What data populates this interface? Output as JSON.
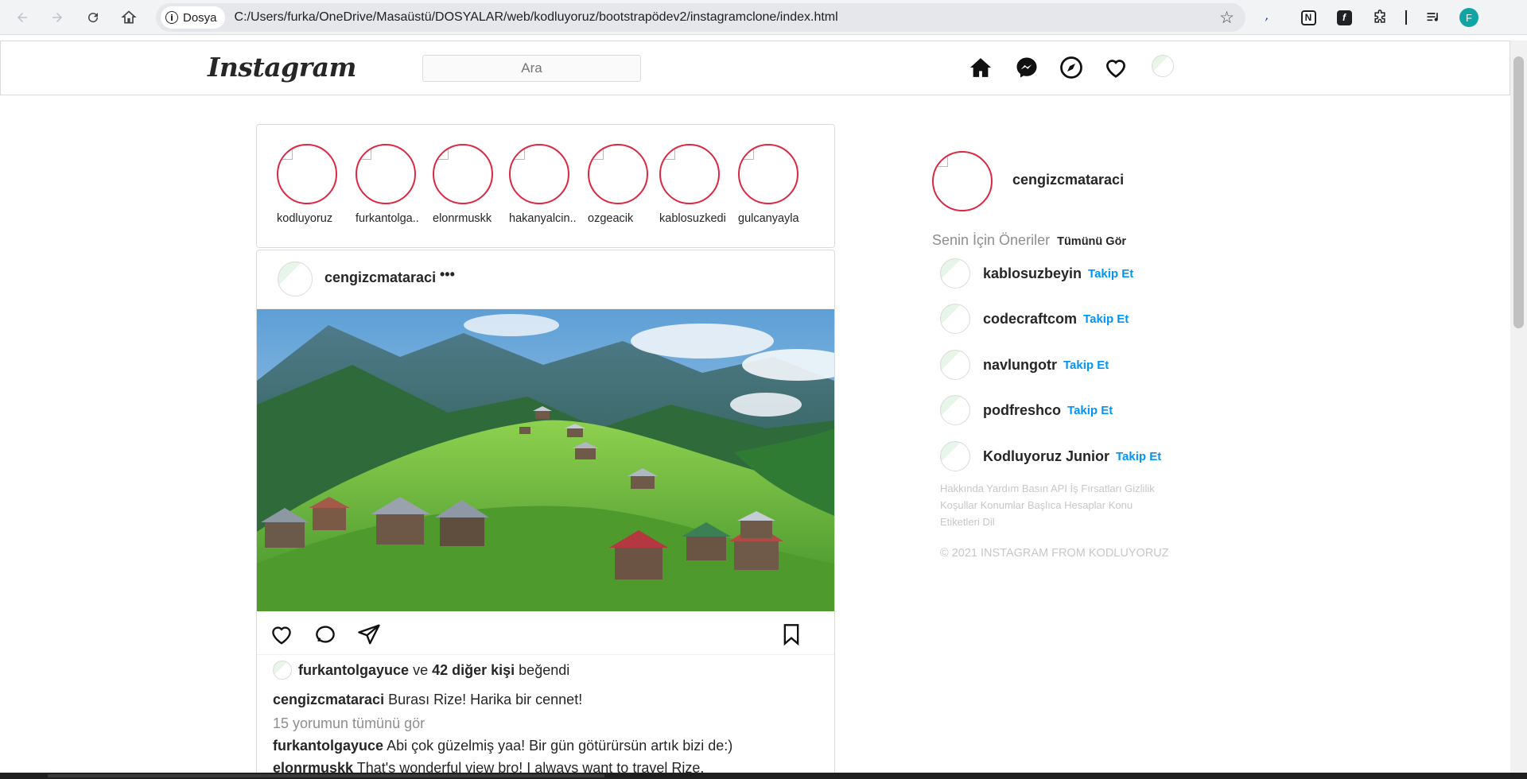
{
  "browser": {
    "chip_label": "Dosya",
    "url": "C:/Users/furka/OneDrive/Masaüstü/DOSYALAR/web/kodluyoruz/bootstrapödev2/instagramclone/index.html",
    "profile_initial": "F"
  },
  "nav": {
    "logo": "Instagram",
    "search_placeholder": "Ara"
  },
  "stories": [
    {
      "name": "kodluyoruz"
    },
    {
      "name": "furkantolga.."
    },
    {
      "name": "elonrmuskk"
    },
    {
      "name": "hakanyalcin.."
    },
    {
      "name": "ozgeacik"
    },
    {
      "name": "kablosuzkedi"
    },
    {
      "name": "gulcanyayla"
    }
  ],
  "post": {
    "username": "cengizcmataraci",
    "more": "•••",
    "liked_by_user": "furkantolgayuce",
    "liked_by_conj": "ve",
    "liked_by_others": "42 diğer kişi",
    "liked_by_suffix": "beğendi",
    "caption_user": "cengizcmataraci",
    "caption_text": "Burası Rize! Harika bir cennet!",
    "view_comments": "15 yorumun tümünü gör",
    "comments": [
      {
        "user": "furkantolgayuce",
        "text": "Abi çok güzelmiş yaa! Bir gün götürürsün artık bizi de:)"
      },
      {
        "user": "elonrmuskk",
        "text": "That's wonderful view bro! I always want to travel Rize."
      }
    ]
  },
  "sidebar": {
    "me": "cengizcmataraci",
    "suggestions_title": "Senin İçin Öneriler",
    "see_all": "Tümünü Gör",
    "follow_label": "Takip Et",
    "suggestions": [
      {
        "user": "kablosuzbeyin"
      },
      {
        "user": "codecraftcom"
      },
      {
        "user": "navlungotr"
      },
      {
        "user": "podfreshco"
      },
      {
        "user": "Kodluyoruz Junior"
      }
    ],
    "footer_links": "Hakkında Yardım Basın API İş Fırsatları Gizlilik Koşullar Konumlar Başlıca Hesaplar Konu Etiketleri Dil",
    "copyright": "© 2021 INSTAGRAM FROM KODLUYORUZ"
  }
}
